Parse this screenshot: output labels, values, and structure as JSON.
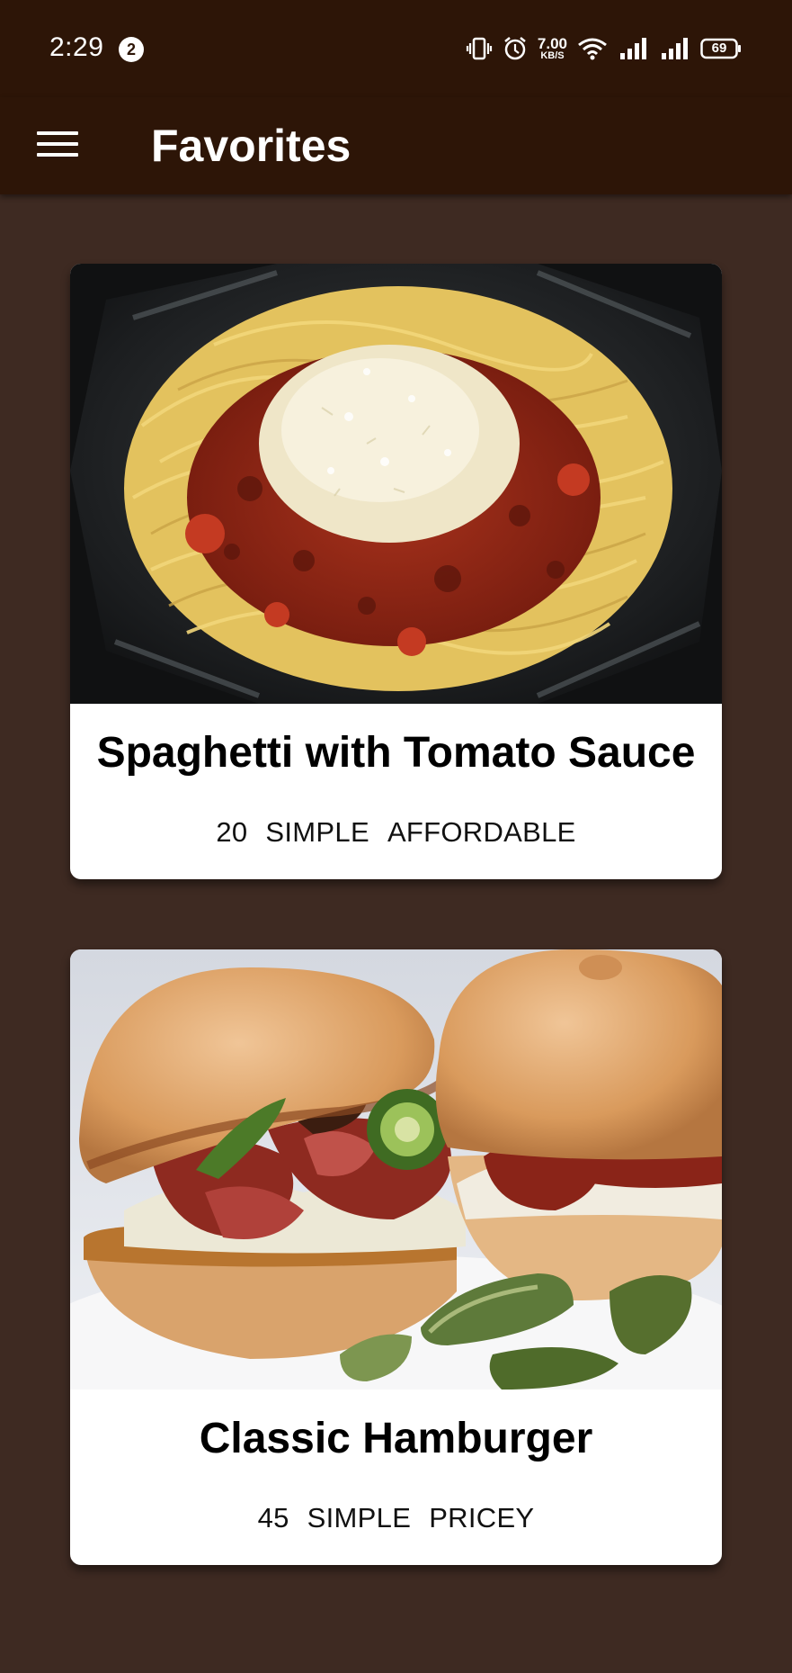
{
  "status_bar": {
    "time": "2:29",
    "notification_count": "2",
    "network_speed_value": "7.00",
    "network_speed_unit": "KB/S",
    "battery_level": "69"
  },
  "app_bar": {
    "title": "Favorites",
    "menu_icon": "hamburger-menu-icon"
  },
  "meals": [
    {
      "title": "Spaghetti with Tomato Sauce",
      "duration": "20",
      "complexity": "SIMPLE",
      "affordability": "AFFORDABLE",
      "image": "spaghetti-photo"
    },
    {
      "title": "Classic Hamburger",
      "duration": "45",
      "complexity": "SIMPLE",
      "affordability": "PRICEY",
      "image": "hamburger-photo"
    }
  ],
  "colors": {
    "app_bar": "#2d1507",
    "background": "#3e2a22",
    "card": "#ffffff"
  }
}
